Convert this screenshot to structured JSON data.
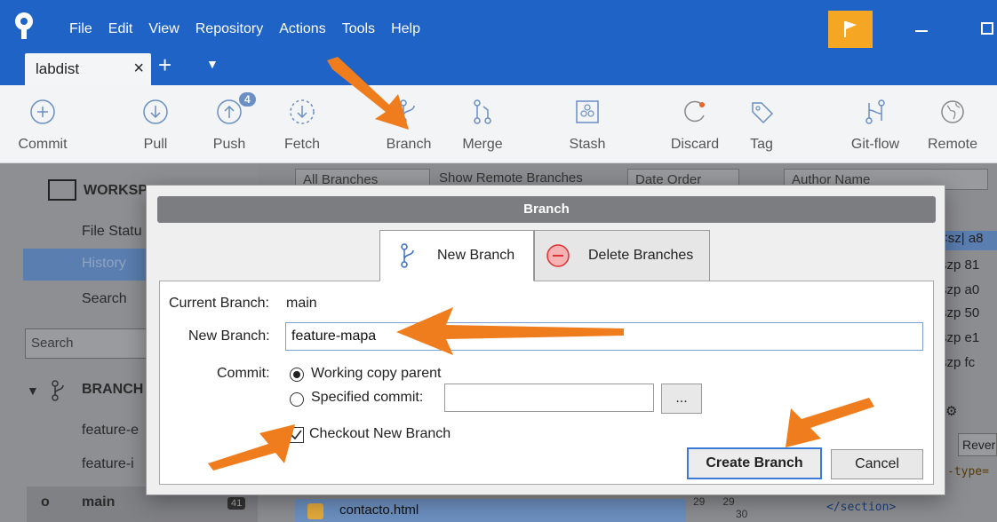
{
  "menu": [
    "File",
    "Edit",
    "View",
    "Repository",
    "Actions",
    "Tools",
    "Help"
  ],
  "tab": {
    "label": "labdist"
  },
  "toolbar": {
    "commit": "Commit",
    "pull": "Pull",
    "push": "Push",
    "push_badge": "4",
    "fetch": "Fetch",
    "branch": "Branch",
    "merge": "Merge",
    "stash": "Stash",
    "discard": "Discard",
    "tag": "Tag",
    "gitflow": "Git-flow",
    "remote": "Remote"
  },
  "sidebar": {
    "workspace": "WORKSP",
    "file_status": "File Statu",
    "history": "History",
    "search_item": "Search",
    "search_placeholder": "Search",
    "branches": "BRANCH",
    "branch_items": [
      "feature-e",
      "feature-i",
      "main"
    ],
    "main_count": "41"
  },
  "background": {
    "all_branches": "All Branches",
    "show_remote": "Show Remote Branches",
    "date_order": "Date Order",
    "author_placeholder": "Author Name",
    "right_rows": [
      "szp  81",
      "szp  a0",
      "szp  50",
      "szp  e1",
      "szp  fc"
    ],
    "right_head": "<sz|  a8",
    "reverse": "Rever",
    "code_type": "-type=",
    "section_close": "</section>",
    "file_name": "contacto.html",
    "line_a": "29",
    "line_b": "30"
  },
  "dialog": {
    "title": "Branch",
    "tab_new": "New Branch",
    "tab_delete": "Delete Branches",
    "current_branch_label": "Current Branch:",
    "current_branch_value": "main",
    "new_branch_label": "New Branch:",
    "new_branch_value": "feature-mapa",
    "commit_label": "Commit:",
    "radio_working": "Working copy parent",
    "radio_specified": "Specified commit:",
    "browse": "...",
    "checkout_label": "Checkout New Branch",
    "create_button": "Create Branch",
    "cancel_button": "Cancel"
  },
  "colors": {
    "title_bar": "#1f63c6",
    "flag": "#f5a623",
    "arrow": "#f07d1d",
    "focus": "#3a7bd5"
  }
}
